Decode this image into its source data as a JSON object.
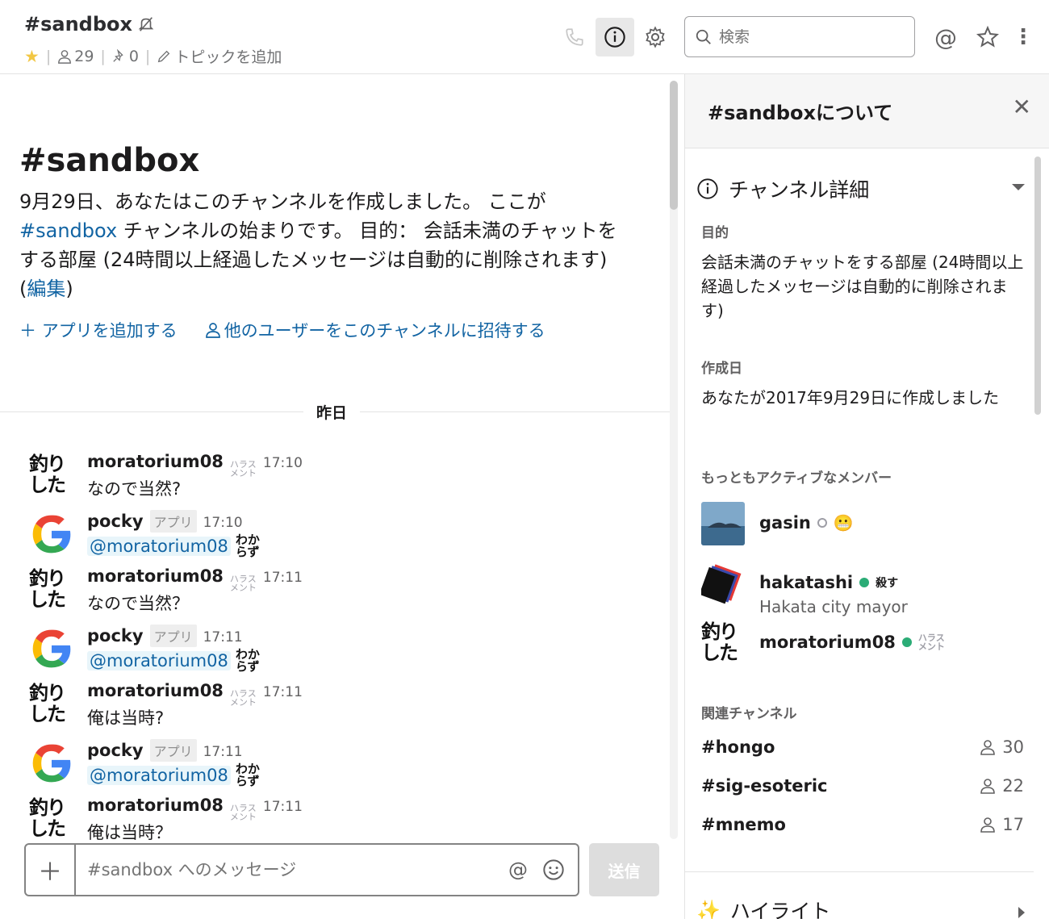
{
  "header": {
    "channel_name": "#sandbox",
    "members_count": "29",
    "pins_count": "0",
    "add_topic": "トピックを追加",
    "search_placeholder": "検索"
  },
  "intro": {
    "title": "#sandbox",
    "text_1": "9月29日、あなたはこのチャンネルを作成しました。 ここが",
    "channel_link": "#sandbox",
    "text_2": " チャンネルの始まりです。 目的： 会話未満のチャットをする部屋 (24時間以上経過したメッセージは自動的に削除されます) (",
    "edit_link": "編集",
    "text_3": ")",
    "add_app": "アプリを追加する",
    "invite": "他のユーザーをこのチャンネルに招待する"
  },
  "divider_label": "昨日",
  "messages": [
    {
      "user": "moratorium08",
      "badge": "ハラス\nメント",
      "time": "17:10",
      "text": "なので当然?"
    },
    {
      "user": "pocky",
      "app_tag": "アプリ",
      "time": "17:10",
      "mention": "@moratorium08",
      "stamp": "わか\nらず"
    },
    {
      "user": "moratorium08",
      "badge": "ハラス\nメント",
      "time": "17:11",
      "text": "なので当然？"
    },
    {
      "user": "pocky",
      "app_tag": "アプリ",
      "time": "17:11",
      "mention": "@moratorium08",
      "stamp": "わか\nらず"
    },
    {
      "user": "moratorium08",
      "badge": "ハラス\nメント",
      "time": "17:11",
      "text": "俺は当時?"
    },
    {
      "user": "pocky",
      "app_tag": "アプリ",
      "time": "17:11",
      "mention": "@moratorium08",
      "stamp": "わか\nらず"
    },
    {
      "user": "moratorium08",
      "badge": "ハラス\nメント",
      "time": "17:11",
      "text": "俺は当時？"
    }
  ],
  "avatar_text": "釣り\nした",
  "composer": {
    "placeholder": "#sandbox へのメッセージ",
    "send_label": "送信"
  },
  "sidebar": {
    "title": "#sandboxについて",
    "details_title": "チャンネル詳細",
    "purpose_label": "目的",
    "purpose_value": "会話未満のチャットをする部屋 (24時間以上経過したメッセージは自動的に削除されます)",
    "created_label": "作成日",
    "created_value": "あなたが2017年9月29日に作成しました",
    "active_label": "もっともアクティブなメンバー",
    "members": [
      {
        "name": "gasin",
        "status": "away"
      },
      {
        "name": "hakatashi",
        "status": "online",
        "sub": "Hakata city mayor",
        "stamp": "殺す"
      },
      {
        "name": "moratorium08",
        "status": "online",
        "badge": "ハラス\nメント"
      }
    ],
    "related_label": "関連チャンネル",
    "related": [
      {
        "name": "#hongo",
        "count": "30"
      },
      {
        "name": "#sig-esoteric",
        "count": "22"
      },
      {
        "name": "#mnemo",
        "count": "17"
      }
    ],
    "highlight_label": "ハイライト"
  }
}
